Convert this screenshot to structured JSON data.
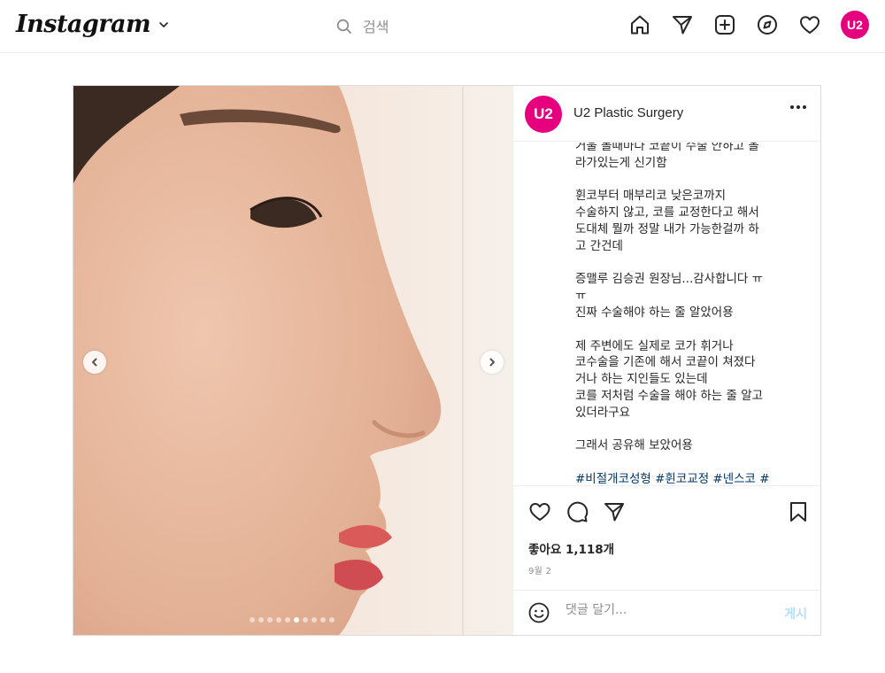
{
  "topnav": {
    "logo": "Instagram",
    "search_placeholder": "검색",
    "profile_avatar": "U2",
    "icons": [
      "home-icon",
      "direct-message-icon",
      "new-post-icon",
      "explore-icon",
      "activity-heart-icon"
    ]
  },
  "post": {
    "username": "U2 Plastic Surgery",
    "avatar_text": "U2",
    "caption": "거울 볼때마다 코끝이 수술 안하고 올\n라가있는게 신기함\n\n휜코부터 매부리코 낮은코까지\n수술하지 않고, 코를 교정한다고 해서\n도대체 뭘까 정말 내가 가능한걸까 하\n고 간건데\n\n증맬루 김승권 원장님...감사합니다 ㅠ\nㅠ\n진짜 수술해야 하는 줄 알았어용\n\n제 주변에도 실제로 코가 휘거나\n코수술을 기존에 해서 코끝이 쳐졌다\n거나 하는 지인들도 있는데\n코를 저처럼 수술을 해야 하는 줄 알고\n있더라구요\n\n그래서 공유해 보았어용\n\n",
    "hashtags": "#비절개코성형 #휜코교정 #넨스코 #",
    "likes_label": "좋아요",
    "likes_count": "1,118개",
    "date": "9월 2",
    "comment_placeholder": "댓글 달기...",
    "post_button": "게시",
    "carousel": {
      "total": 10,
      "active_index": 5
    }
  },
  "colors": {
    "brand_pink": "#e6007e",
    "post_button_disabled": "#b2dffc",
    "hashtag": "#00376b"
  }
}
